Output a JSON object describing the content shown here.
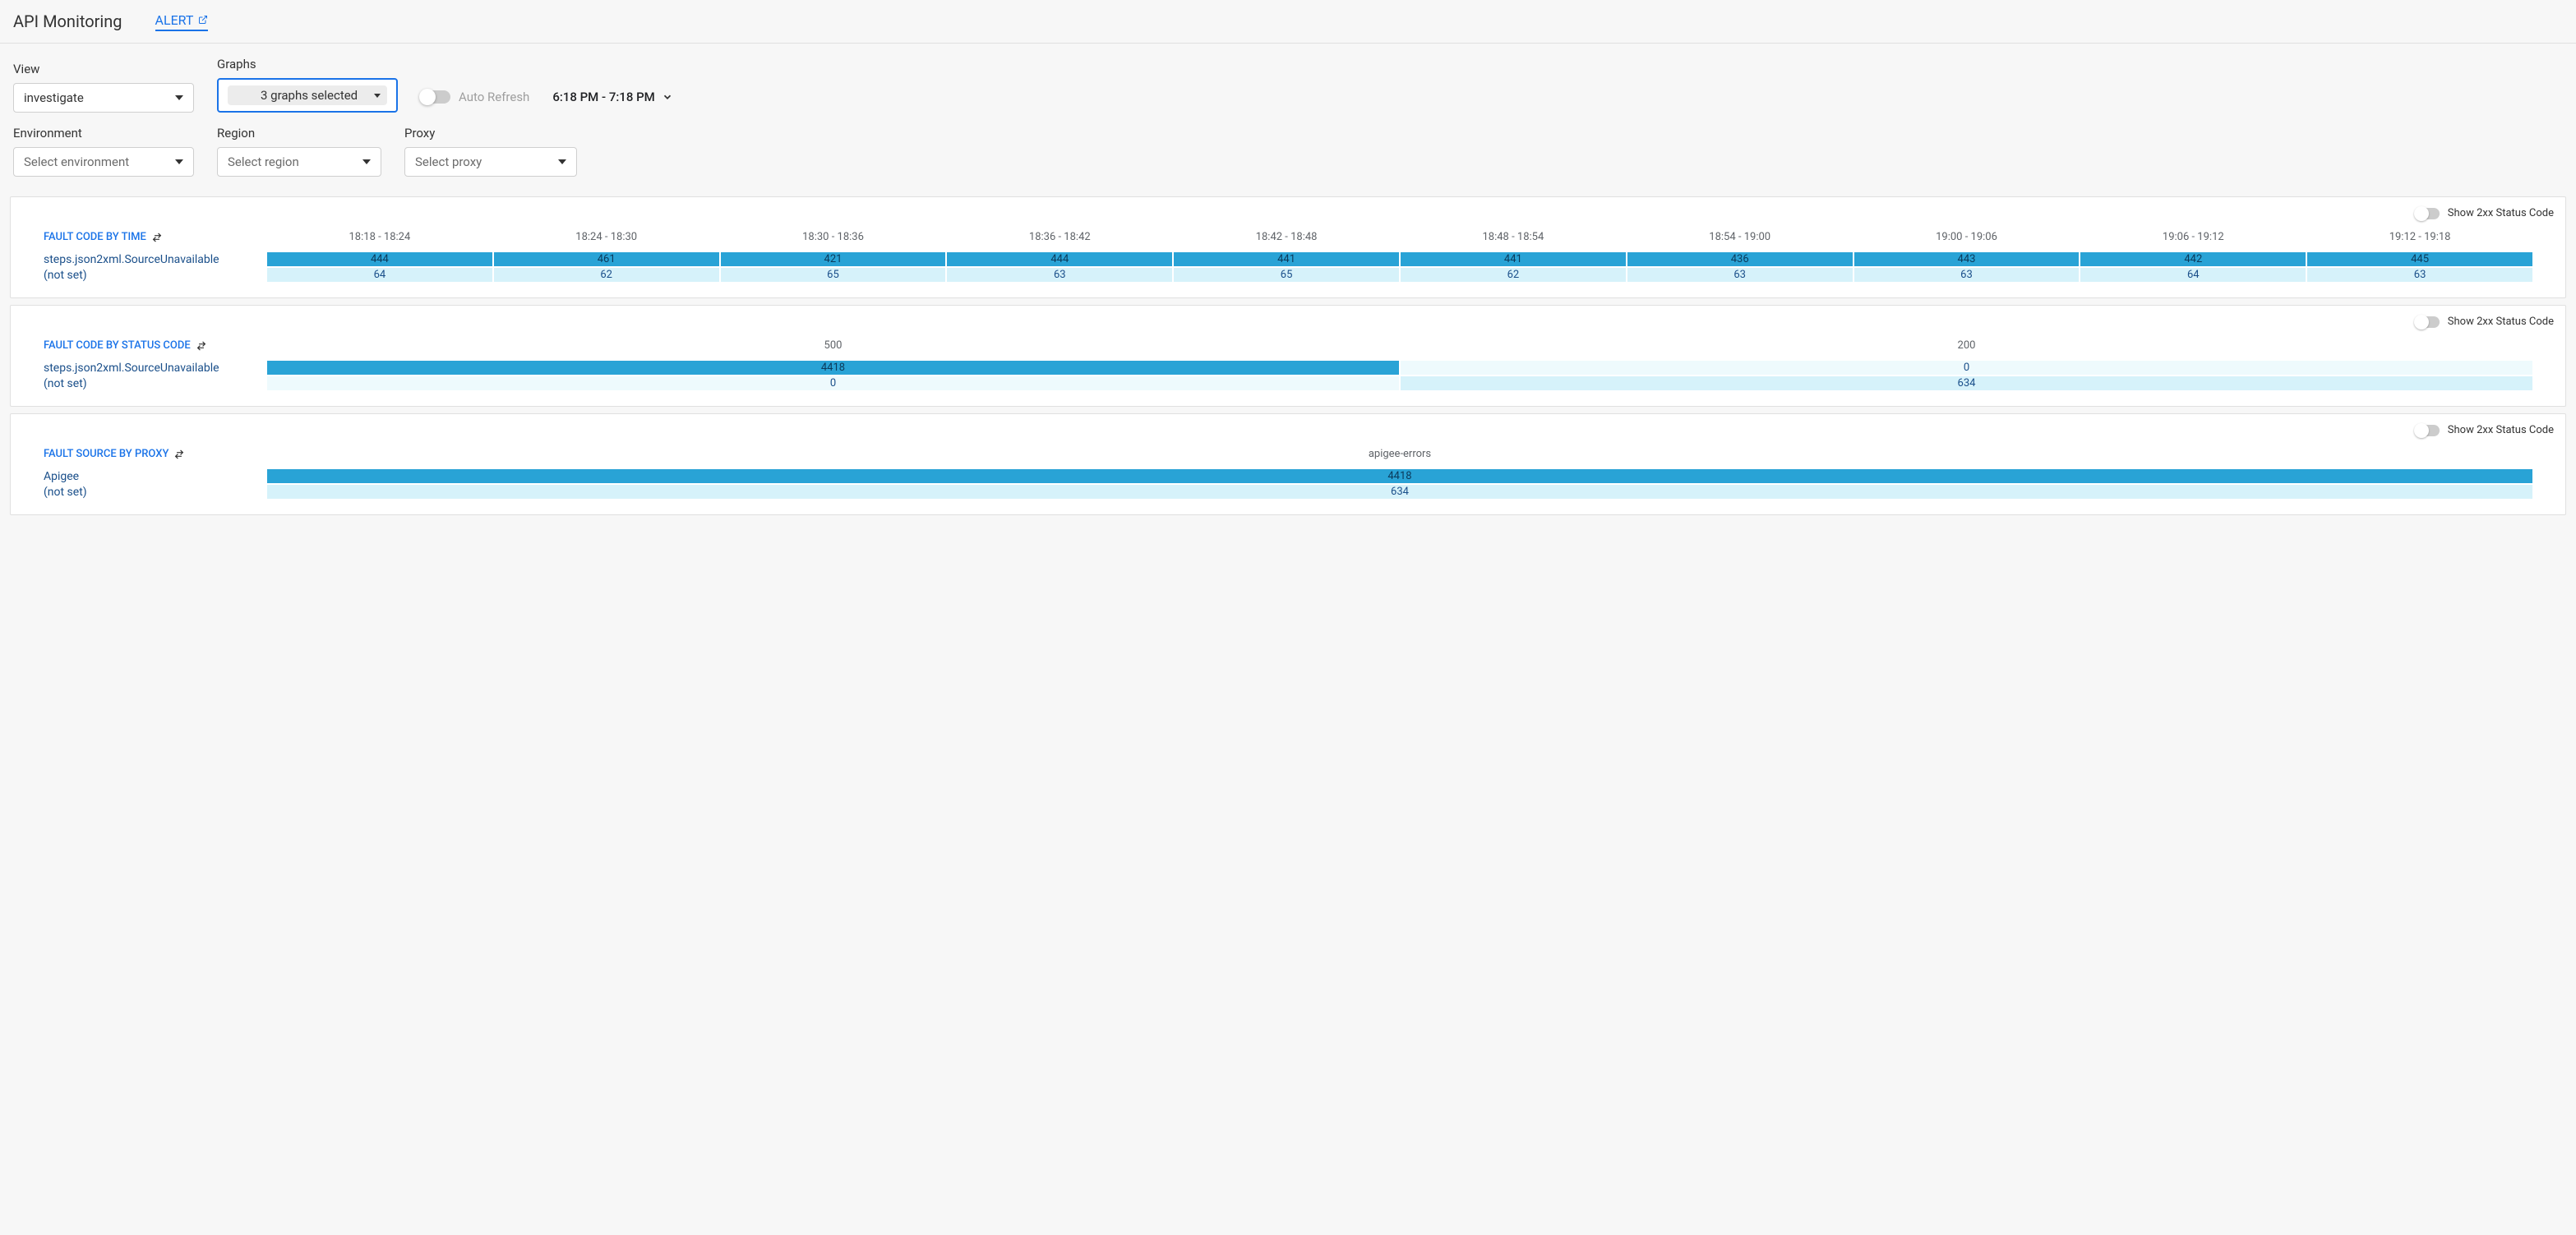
{
  "header": {
    "title": "API Monitoring",
    "alert_label": "ALERT"
  },
  "controls": {
    "view": {
      "label": "View",
      "value": "investigate"
    },
    "graphs": {
      "label": "Graphs",
      "value": "3 graphs selected"
    },
    "auto_refresh": {
      "label": "Auto Refresh"
    },
    "time_range": {
      "value": "6:18 PM - 7:18 PM"
    },
    "environment": {
      "label": "Environment",
      "placeholder": "Select environment"
    },
    "region": {
      "label": "Region",
      "placeholder": "Select region"
    },
    "proxy": {
      "label": "Proxy",
      "placeholder": "Select proxy"
    }
  },
  "common": {
    "show_2xx": "Show 2xx Status Code"
  },
  "panels": {
    "by_time": {
      "title": "FAULT CODE BY TIME",
      "columns": [
        "18:18 - 18:24",
        "18:24 - 18:30",
        "18:30 - 18:36",
        "18:36 - 18:42",
        "18:42 - 18:48",
        "18:48 - 18:54",
        "18:54 - 19:00",
        "19:00 - 19:06",
        "19:06 - 19:12",
        "19:12 - 19:18"
      ],
      "rows": [
        {
          "label": "steps.json2xml.SourceUnavailable",
          "values": [
            "444",
            "461",
            "421",
            "444",
            "441",
            "441",
            "436",
            "443",
            "442",
            "445"
          ],
          "tone": "dark"
        },
        {
          "label": "(not set)",
          "values": [
            "64",
            "62",
            "65",
            "63",
            "65",
            "62",
            "63",
            "63",
            "64",
            "63"
          ],
          "tone": "light"
        }
      ]
    },
    "by_status": {
      "title": "FAULT CODE BY STATUS CODE",
      "columns": [
        "500",
        "200"
      ],
      "rows": [
        {
          "label": "steps.json2xml.SourceUnavailable",
          "values": [
            "4418",
            "0"
          ],
          "tones": [
            "dark",
            "xlight"
          ]
        },
        {
          "label": "(not set)",
          "values": [
            "0",
            "634"
          ],
          "tones": [
            "xlight",
            "light"
          ]
        }
      ]
    },
    "by_proxy": {
      "title": "FAULT SOURCE BY PROXY",
      "columns": [
        "apigee-errors"
      ],
      "rows": [
        {
          "label": "Apigee",
          "values": [
            "4418"
          ],
          "tone": "dark"
        },
        {
          "label": "(not set)",
          "values": [
            "634"
          ],
          "tone": "light"
        }
      ]
    }
  },
  "chart_data": [
    {
      "type": "heatmap",
      "title": "FAULT CODE BY TIME",
      "x": [
        "18:18 - 18:24",
        "18:24 - 18:30",
        "18:30 - 18:36",
        "18:36 - 18:42",
        "18:42 - 18:48",
        "18:48 - 18:54",
        "18:54 - 19:00",
        "19:00 - 19:06",
        "19:06 - 19:12",
        "19:12 - 19:18"
      ],
      "series": [
        {
          "name": "steps.json2xml.SourceUnavailable",
          "values": [
            444,
            461,
            421,
            444,
            441,
            441,
            436,
            443,
            442,
            445
          ]
        },
        {
          "name": "(not set)",
          "values": [
            64,
            62,
            65,
            63,
            65,
            62,
            63,
            63,
            64,
            63
          ]
        }
      ]
    },
    {
      "type": "heatmap",
      "title": "FAULT CODE BY STATUS CODE",
      "x": [
        "500",
        "200"
      ],
      "series": [
        {
          "name": "steps.json2xml.SourceUnavailable",
          "values": [
            4418,
            0
          ]
        },
        {
          "name": "(not set)",
          "values": [
            0,
            634
          ]
        }
      ]
    },
    {
      "type": "heatmap",
      "title": "FAULT SOURCE BY PROXY",
      "x": [
        "apigee-errors"
      ],
      "series": [
        {
          "name": "Apigee",
          "values": [
            4418
          ]
        },
        {
          "name": "(not set)",
          "values": [
            634
          ]
        }
      ]
    }
  ]
}
